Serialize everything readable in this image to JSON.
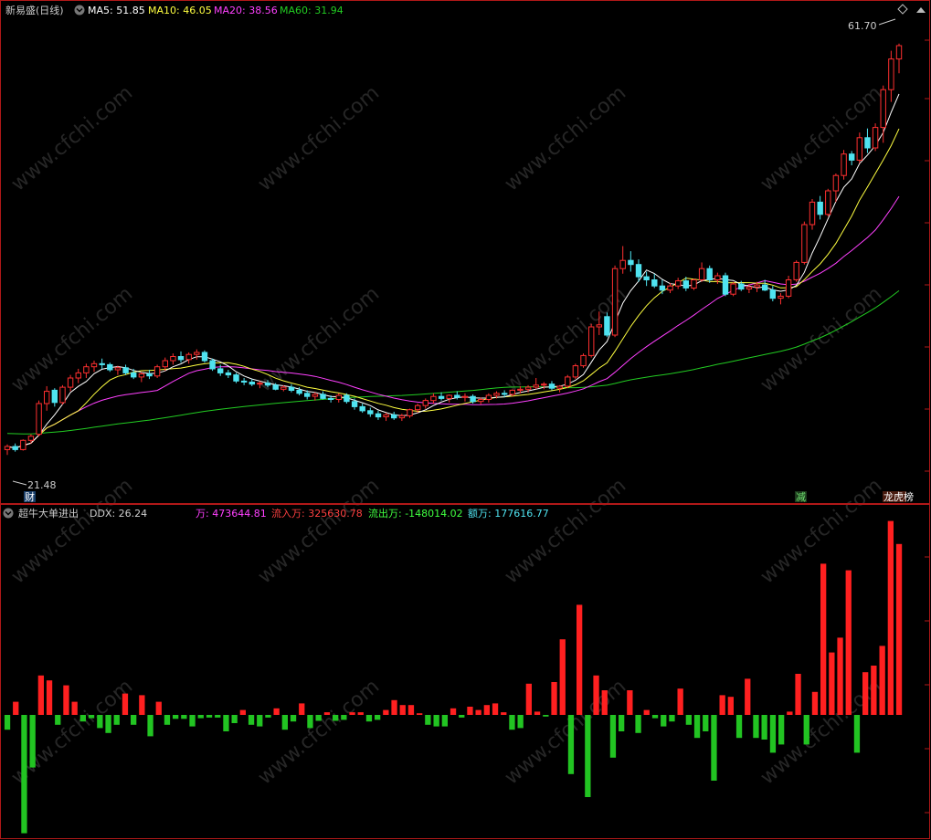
{
  "colors": {
    "background": "#000000",
    "frame": "#b01818",
    "up": "#ff3030",
    "down": "#4fe3f0",
    "ma5": "#ffffff",
    "ma10": "#ffff40",
    "ma20": "#ff40ff",
    "ma60": "#22cc22",
    "bar_pos": "#ff2020",
    "bar_neg": "#22c422",
    "label_gray": "#cccccc",
    "label_cyan": "#4fe3f0"
  },
  "header": {
    "title": "新易盛(日线)",
    "ma5": "MA5: 51.85",
    "ma10": "MA10: 46.05",
    "ma20": "MA20: 38.56",
    "ma60": "MA60: 31.94"
  },
  "price_labels": {
    "high": "61.70",
    "low": "21.48"
  },
  "markers": {
    "cai": "财",
    "jian": "减",
    "bang": "龙虎榜"
  },
  "indicator_header": {
    "name": "超牛大单进出",
    "ddx": "DDX: 26.24",
    "wan": "万: 473644.81",
    "inflow": "流入万: 325630.78",
    "outflow": "流出万: -148014.02",
    "amount": "额万: 177616.77"
  },
  "watermark": "www.cfchi.com",
  "chart_data": [
    {
      "type": "candlestick",
      "title": "新易盛(日线)",
      "ylim": [
        19,
        64
      ],
      "series": [
        {
          "name": "MA5",
          "last": 51.85
        },
        {
          "name": "MA10",
          "last": 46.05
        },
        {
          "name": "MA20",
          "last": 38.56
        },
        {
          "name": "MA60",
          "last": 31.94
        }
      ],
      "candles": [
        [
          22.0,
          22.5,
          21.48,
          22.3
        ],
        [
          22.3,
          22.6,
          21.8,
          22.0
        ],
        [
          22.0,
          23.0,
          21.9,
          22.9
        ],
        [
          22.9,
          23.5,
          22.6,
          23.3
        ],
        [
          23.5,
          26.8,
          23.3,
          26.5
        ],
        [
          26.5,
          28.2,
          25.8,
          27.7
        ],
        [
          27.8,
          28.0,
          26.2,
          26.6
        ],
        [
          26.6,
          28.3,
          26.4,
          28.1
        ],
        [
          28.1,
          29.3,
          27.7,
          29.0
        ],
        [
          29.0,
          29.9,
          28.5,
          29.5
        ],
        [
          29.5,
          30.4,
          29.0,
          30.1
        ],
        [
          30.1,
          30.7,
          29.6,
          30.4
        ],
        [
          30.4,
          30.9,
          29.9,
          30.3
        ],
        [
          30.3,
          30.5,
          29.6,
          29.8
        ],
        [
          29.8,
          30.2,
          29.3,
          30.0
        ],
        [
          30.0,
          30.3,
          29.3,
          29.5
        ],
        [
          29.5,
          29.9,
          28.9,
          29.1
        ],
        [
          29.1,
          29.6,
          28.6,
          29.4
        ],
        [
          29.4,
          29.8,
          28.9,
          29.2
        ],
        [
          29.2,
          30.3,
          29.0,
          30.1
        ],
        [
          30.1,
          31.0,
          29.7,
          30.7
        ],
        [
          30.7,
          31.4,
          30.3,
          31.1
        ],
        [
          31.1,
          31.6,
          30.5,
          30.8
        ],
        [
          30.8,
          31.5,
          30.4,
          31.3
        ],
        [
          31.3,
          31.8,
          30.8,
          31.5
        ],
        [
          31.5,
          31.7,
          30.5,
          30.7
        ],
        [
          30.7,
          30.9,
          29.7,
          29.9
        ],
        [
          29.9,
          30.3,
          29.2,
          29.5
        ],
        [
          29.5,
          29.8,
          29.0,
          29.3
        ],
        [
          29.3,
          29.5,
          28.5,
          28.7
        ],
        [
          28.7,
          29.0,
          28.3,
          28.6
        ],
        [
          28.6,
          28.9,
          28.2,
          28.4
        ],
        [
          28.4,
          28.7,
          28.0,
          28.5
        ],
        [
          28.5,
          28.8,
          28.1,
          28.3
        ],
        [
          28.3,
          28.5,
          27.8,
          27.9
        ],
        [
          27.9,
          28.3,
          27.7,
          28.1
        ],
        [
          28.1,
          28.4,
          27.6,
          27.8
        ],
        [
          27.8,
          28.1,
          27.3,
          27.5
        ],
        [
          27.5,
          27.8,
          26.9,
          27.2
        ],
        [
          27.2,
          27.6,
          26.8,
          27.4
        ],
        [
          27.4,
          27.7,
          26.9,
          27.0
        ],
        [
          27.0,
          27.3,
          26.6,
          26.9
        ],
        [
          26.9,
          27.5,
          26.6,
          27.3
        ],
        [
          27.3,
          27.5,
          26.5,
          26.7
        ],
        [
          26.7,
          27.0,
          25.9,
          26.2
        ],
        [
          26.2,
          26.5,
          25.6,
          25.8
        ],
        [
          25.8,
          26.1,
          25.2,
          25.5
        ],
        [
          25.5,
          25.8,
          24.9,
          25.2
        ],
        [
          25.2,
          25.6,
          24.8,
          25.4
        ],
        [
          25.4,
          25.7,
          24.9,
          25.1
        ],
        [
          25.1,
          25.5,
          24.8,
          25.3
        ],
        [
          25.3,
          26.0,
          25.1,
          25.9
        ],
        [
          25.9,
          26.5,
          25.6,
          26.3
        ],
        [
          26.3,
          27.0,
          26.0,
          26.8
        ],
        [
          26.8,
          27.5,
          26.5,
          27.2
        ],
        [
          27.2,
          27.6,
          26.8,
          27.0
        ],
        [
          27.0,
          27.4,
          26.6,
          27.3
        ],
        [
          27.3,
          27.7,
          26.9,
          27.1
        ],
        [
          27.1,
          27.5,
          26.7,
          27.2
        ],
        [
          27.2,
          27.4,
          26.5,
          26.7
        ],
        [
          26.7,
          27.1,
          26.4,
          26.9
        ],
        [
          26.9,
          27.5,
          26.6,
          27.3
        ],
        [
          27.3,
          27.7,
          27.0,
          27.5
        ],
        [
          27.5,
          27.8,
          27.1,
          27.4
        ],
        [
          27.4,
          27.9,
          27.2,
          27.8
        ],
        [
          27.8,
          28.2,
          27.5,
          27.9
        ],
        [
          27.9,
          28.3,
          27.6,
          28.1
        ],
        [
          28.1,
          29.0,
          27.9,
          28.3
        ],
        [
          28.3,
          28.6,
          27.9,
          28.4
        ],
        [
          28.4,
          28.7,
          27.8,
          28.0
        ],
        [
          28.0,
          28.3,
          27.6,
          28.2
        ],
        [
          28.2,
          29.3,
          28.0,
          29.1
        ],
        [
          29.1,
          30.4,
          28.9,
          30.2
        ],
        [
          30.2,
          31.4,
          30.0,
          31.2
        ],
        [
          31.2,
          34.3,
          31.0,
          34.0
        ],
        [
          34.0,
          35.5,
          33.2,
          34.2
        ],
        [
          35.0,
          35.4,
          33.0,
          33.2
        ],
        [
          33.2,
          40.0,
          33.0,
          39.7
        ],
        [
          39.7,
          41.9,
          39.2,
          40.5
        ],
        [
          40.5,
          41.4,
          39.4,
          40.1
        ],
        [
          40.1,
          40.6,
          38.4,
          38.9
        ],
        [
          38.9,
          39.4,
          38.0,
          38.6
        ],
        [
          38.6,
          39.2,
          37.8,
          38.0
        ],
        [
          38.0,
          38.6,
          37.2,
          37.6
        ],
        [
          37.6,
          38.3,
          37.3,
          38.0
        ],
        [
          38.0,
          38.8,
          37.7,
          38.5
        ],
        [
          38.5,
          38.9,
          37.5,
          37.8
        ],
        [
          37.8,
          38.7,
          37.6,
          38.6
        ],
        [
          38.6,
          40.3,
          38.4,
          39.7
        ],
        [
          39.7,
          40.0,
          38.3,
          38.6
        ],
        [
          38.6,
          39.3,
          38.2,
          39.0
        ],
        [
          39.0,
          39.3,
          37.0,
          37.2
        ],
        [
          37.2,
          38.4,
          37.0,
          38.2
        ],
        [
          38.2,
          38.5,
          37.5,
          37.7
        ],
        [
          37.7,
          38.2,
          37.3,
          37.9
        ],
        [
          37.9,
          38.4,
          37.4,
          38.1
        ],
        [
          38.1,
          38.6,
          37.5,
          37.6
        ],
        [
          37.6,
          38.0,
          36.5,
          36.8
        ],
        [
          36.8,
          37.3,
          36.2,
          37.0
        ],
        [
          37.0,
          39.0,
          36.8,
          38.6
        ],
        [
          38.6,
          40.5,
          38.4,
          40.3
        ],
        [
          40.3,
          44.3,
          40.1,
          44.0
        ],
        [
          44.0,
          46.5,
          43.5,
          46.2
        ],
        [
          46.2,
          46.8,
          44.5,
          45.0
        ],
        [
          45.0,
          47.5,
          44.8,
          47.3
        ],
        [
          47.3,
          49.0,
          46.2,
          48.8
        ],
        [
          48.8,
          51.3,
          48.4,
          50.9
        ],
        [
          50.9,
          51.2,
          49.8,
          50.3
        ],
        [
          50.3,
          53.0,
          50.0,
          52.5
        ],
        [
          52.5,
          53.4,
          51.0,
          51.5
        ],
        [
          51.5,
          53.9,
          51.2,
          53.5
        ],
        [
          53.5,
          57.6,
          52.0,
          57.2
        ],
        [
          57.2,
          61.0,
          56.0,
          60.2
        ],
        [
          60.2,
          61.7,
          58.8,
          61.5
        ]
      ]
    },
    {
      "type": "bar",
      "title": "超牛大单进出",
      "ylim": [
        -3.6,
        5.8
      ],
      "values": [
        -0.45,
        0.4,
        -3.6,
        -1.6,
        1.2,
        1.05,
        -0.3,
        0.9,
        0.4,
        -0.2,
        -0.1,
        -0.4,
        -0.55,
        -0.3,
        0.65,
        -0.3,
        0.6,
        -0.65,
        0.4,
        -0.3,
        -0.12,
        -0.12,
        -0.35,
        -0.1,
        -0.08,
        -0.08,
        -0.5,
        -0.25,
        0.15,
        -0.3,
        -0.35,
        -0.08,
        0.2,
        -0.45,
        -0.2,
        0.35,
        -0.4,
        -0.18,
        0.08,
        -0.18,
        -0.15,
        0.08,
        0.08,
        -0.2,
        -0.15,
        0.15,
        0.45,
        0.3,
        0.3,
        0.05,
        -0.3,
        -0.35,
        -0.35,
        0.2,
        -0.08,
        0.25,
        0.15,
        0.3,
        0.35,
        0.08,
        -0.45,
        -0.4,
        0.95,
        0.1,
        -0.05,
        1.0,
        2.3,
        -1.8,
        3.35,
        -2.5,
        1.2,
        0.75,
        -1.3,
        -0.5,
        0.75,
        -0.55,
        0.15,
        -0.1,
        -0.35,
        -0.2,
        0.8,
        -0.3,
        -0.7,
        -0.5,
        -2.0,
        0.6,
        0.55,
        -0.7,
        1.1,
        -0.7,
        -0.75,
        -1.15,
        -0.9,
        0.1,
        1.25,
        -0.9,
        0.7,
        4.6,
        1.9,
        2.35,
        4.4,
        -1.15,
        1.3,
        1.5,
        2.1,
        5.9,
        5.2
      ]
    }
  ]
}
